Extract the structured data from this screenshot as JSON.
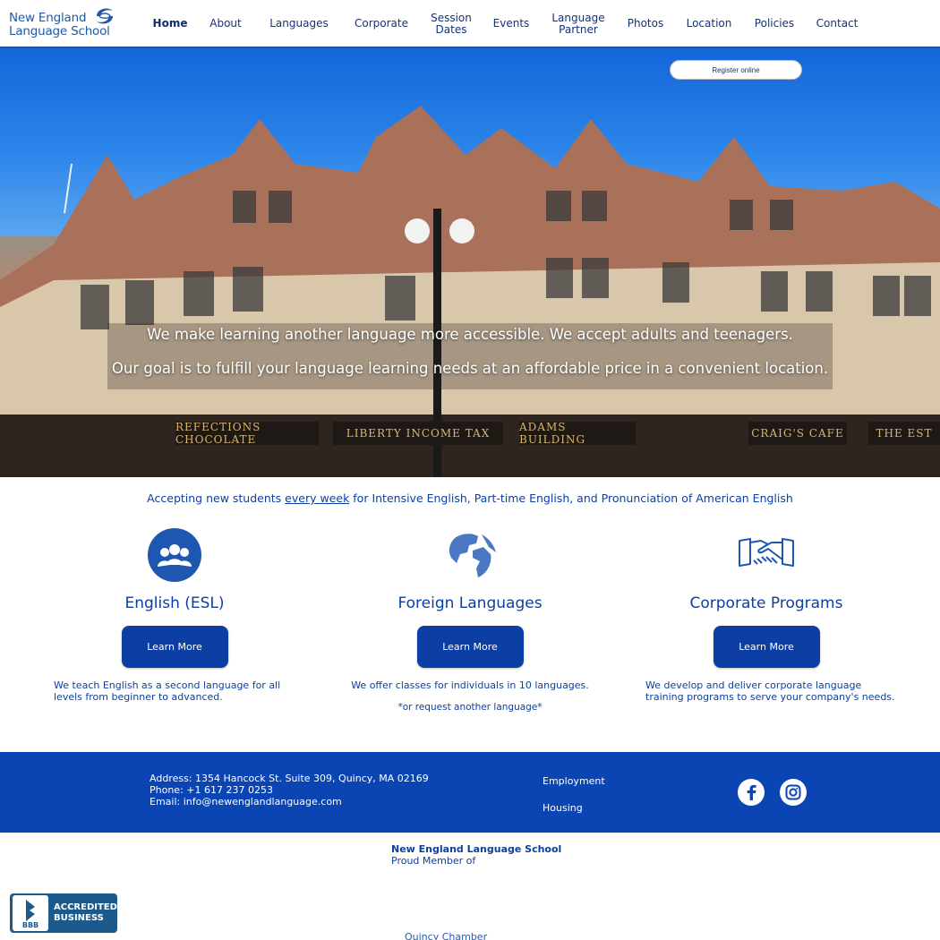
{
  "brand": {
    "logo_line1": "New England",
    "logo_line2": "Language School"
  },
  "nav": [
    {
      "label": "Home",
      "active": true
    },
    {
      "label": "About"
    },
    {
      "label": "Languages"
    },
    {
      "label": "Corporate"
    },
    {
      "label": "Session\nDates"
    },
    {
      "label": "Events"
    },
    {
      "label": "Language\nPartner"
    },
    {
      "label": "Photos"
    },
    {
      "label": "Location"
    },
    {
      "label": "Policies"
    },
    {
      "label": "Contact"
    }
  ],
  "hero": {
    "register_label": "Register online",
    "line1": "We make learning another language more accessible. We accept adults and teenagers.",
    "line2": "Our goal is to fulfill your language learning needs at an affordable price in a convenient location.",
    "signs": [
      "REFECTIONS CHOCOLATE",
      "LIBERTY INCOME TAX",
      "ADAMS BUILDING",
      "CRAIG'S CAFE",
      "THE EST"
    ]
  },
  "announcement": {
    "before": "Accepting new students ",
    "emphasis": "every week",
    "after": " for Intensive English, Part-time English, and Pronunciation of American English"
  },
  "programs": [
    {
      "title": "English (ESL)",
      "button": "Learn More",
      "desc": "We teach English as a second language for all levels from beginner to advanced.",
      "icon": "group-icon"
    },
    {
      "title": "Foreign Languages",
      "button": "Learn More",
      "desc": "We offer classes for individuals in 10 languages.",
      "note": "*or request another language*",
      "icon": "globe-icon"
    },
    {
      "title": "Corporate Programs",
      "button": "Learn More",
      "desc": "We develop and deliver corporate language training programs to serve your company's needs.",
      "icon": "handshake-icon"
    }
  ],
  "footer": {
    "address": "Address: 1354 Hancock St. Suite 309, Quincy, MA 02169",
    "phone": "Phone: +1 617 237 0253",
    "email": "Email: info@newenglandlanguage.com",
    "links": [
      "Employment",
      "Housing"
    ],
    "social": [
      "facebook-icon",
      "instagram-icon"
    ]
  },
  "membership": {
    "name": "New England Language School",
    "caption": "Proud Member of",
    "bbb_line1": "ACCREDITED",
    "bbb_line2": "BUSINESS",
    "bbb_mark": "BBB",
    "quincy": "Quincy Chamber"
  },
  "colors": {
    "brand_blue": "#0c3f9e",
    "footer_blue": "#0b45b4",
    "button_blue": "#0d3ea3"
  }
}
